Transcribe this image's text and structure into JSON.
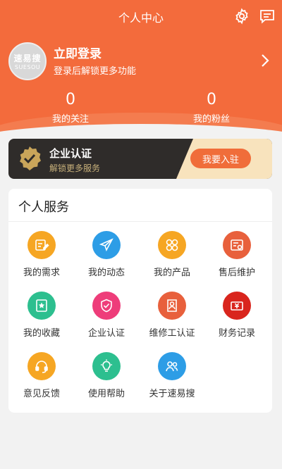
{
  "header": {
    "title": "个人中心",
    "settings_icon": "gear-icon",
    "messages_icon": "message-icon",
    "avatar_text_cn": "速易搜",
    "avatar_text_en": "SUESOU",
    "login_title": "立即登录",
    "login_subtitle": "登录后解锁更多功能",
    "stats": [
      {
        "value": "0",
        "label": "我的关注"
      },
      {
        "value": "0",
        "label": "我的粉丝"
      }
    ]
  },
  "enterprise": {
    "title": "企业认证",
    "subtitle": "解锁更多服务",
    "button": "我要入驻"
  },
  "services": {
    "title": "个人服务",
    "items": [
      {
        "label": "我的需求",
        "icon": "edit-icon",
        "color": "#f6a623"
      },
      {
        "label": "我的动态",
        "icon": "paper-plane-icon",
        "color": "#2d9de6"
      },
      {
        "label": "我的产品",
        "icon": "product-grid-icon",
        "color": "#f6a623"
      },
      {
        "label": "售后维护",
        "icon": "service-card-icon",
        "color": "#e8603c"
      },
      {
        "label": "我的收藏",
        "icon": "star-bookmark-icon",
        "color": "#2dbf8f"
      },
      {
        "label": "企业认证",
        "icon": "shield-check-icon",
        "color": "#ee3d7a"
      },
      {
        "label": "维修工认证",
        "icon": "repairman-icon",
        "color": "#e8603c"
      },
      {
        "label": "财务记录",
        "icon": "finance-icon",
        "color": "#d9251d"
      },
      {
        "label": "意见反馈",
        "icon": "headset-icon",
        "color": "#f6a623"
      },
      {
        "label": "使用帮助",
        "icon": "lightbulb-icon",
        "color": "#2dbf8f"
      },
      {
        "label": "关于速易搜",
        "icon": "people-icon",
        "color": "#2d9de6"
      }
    ]
  }
}
